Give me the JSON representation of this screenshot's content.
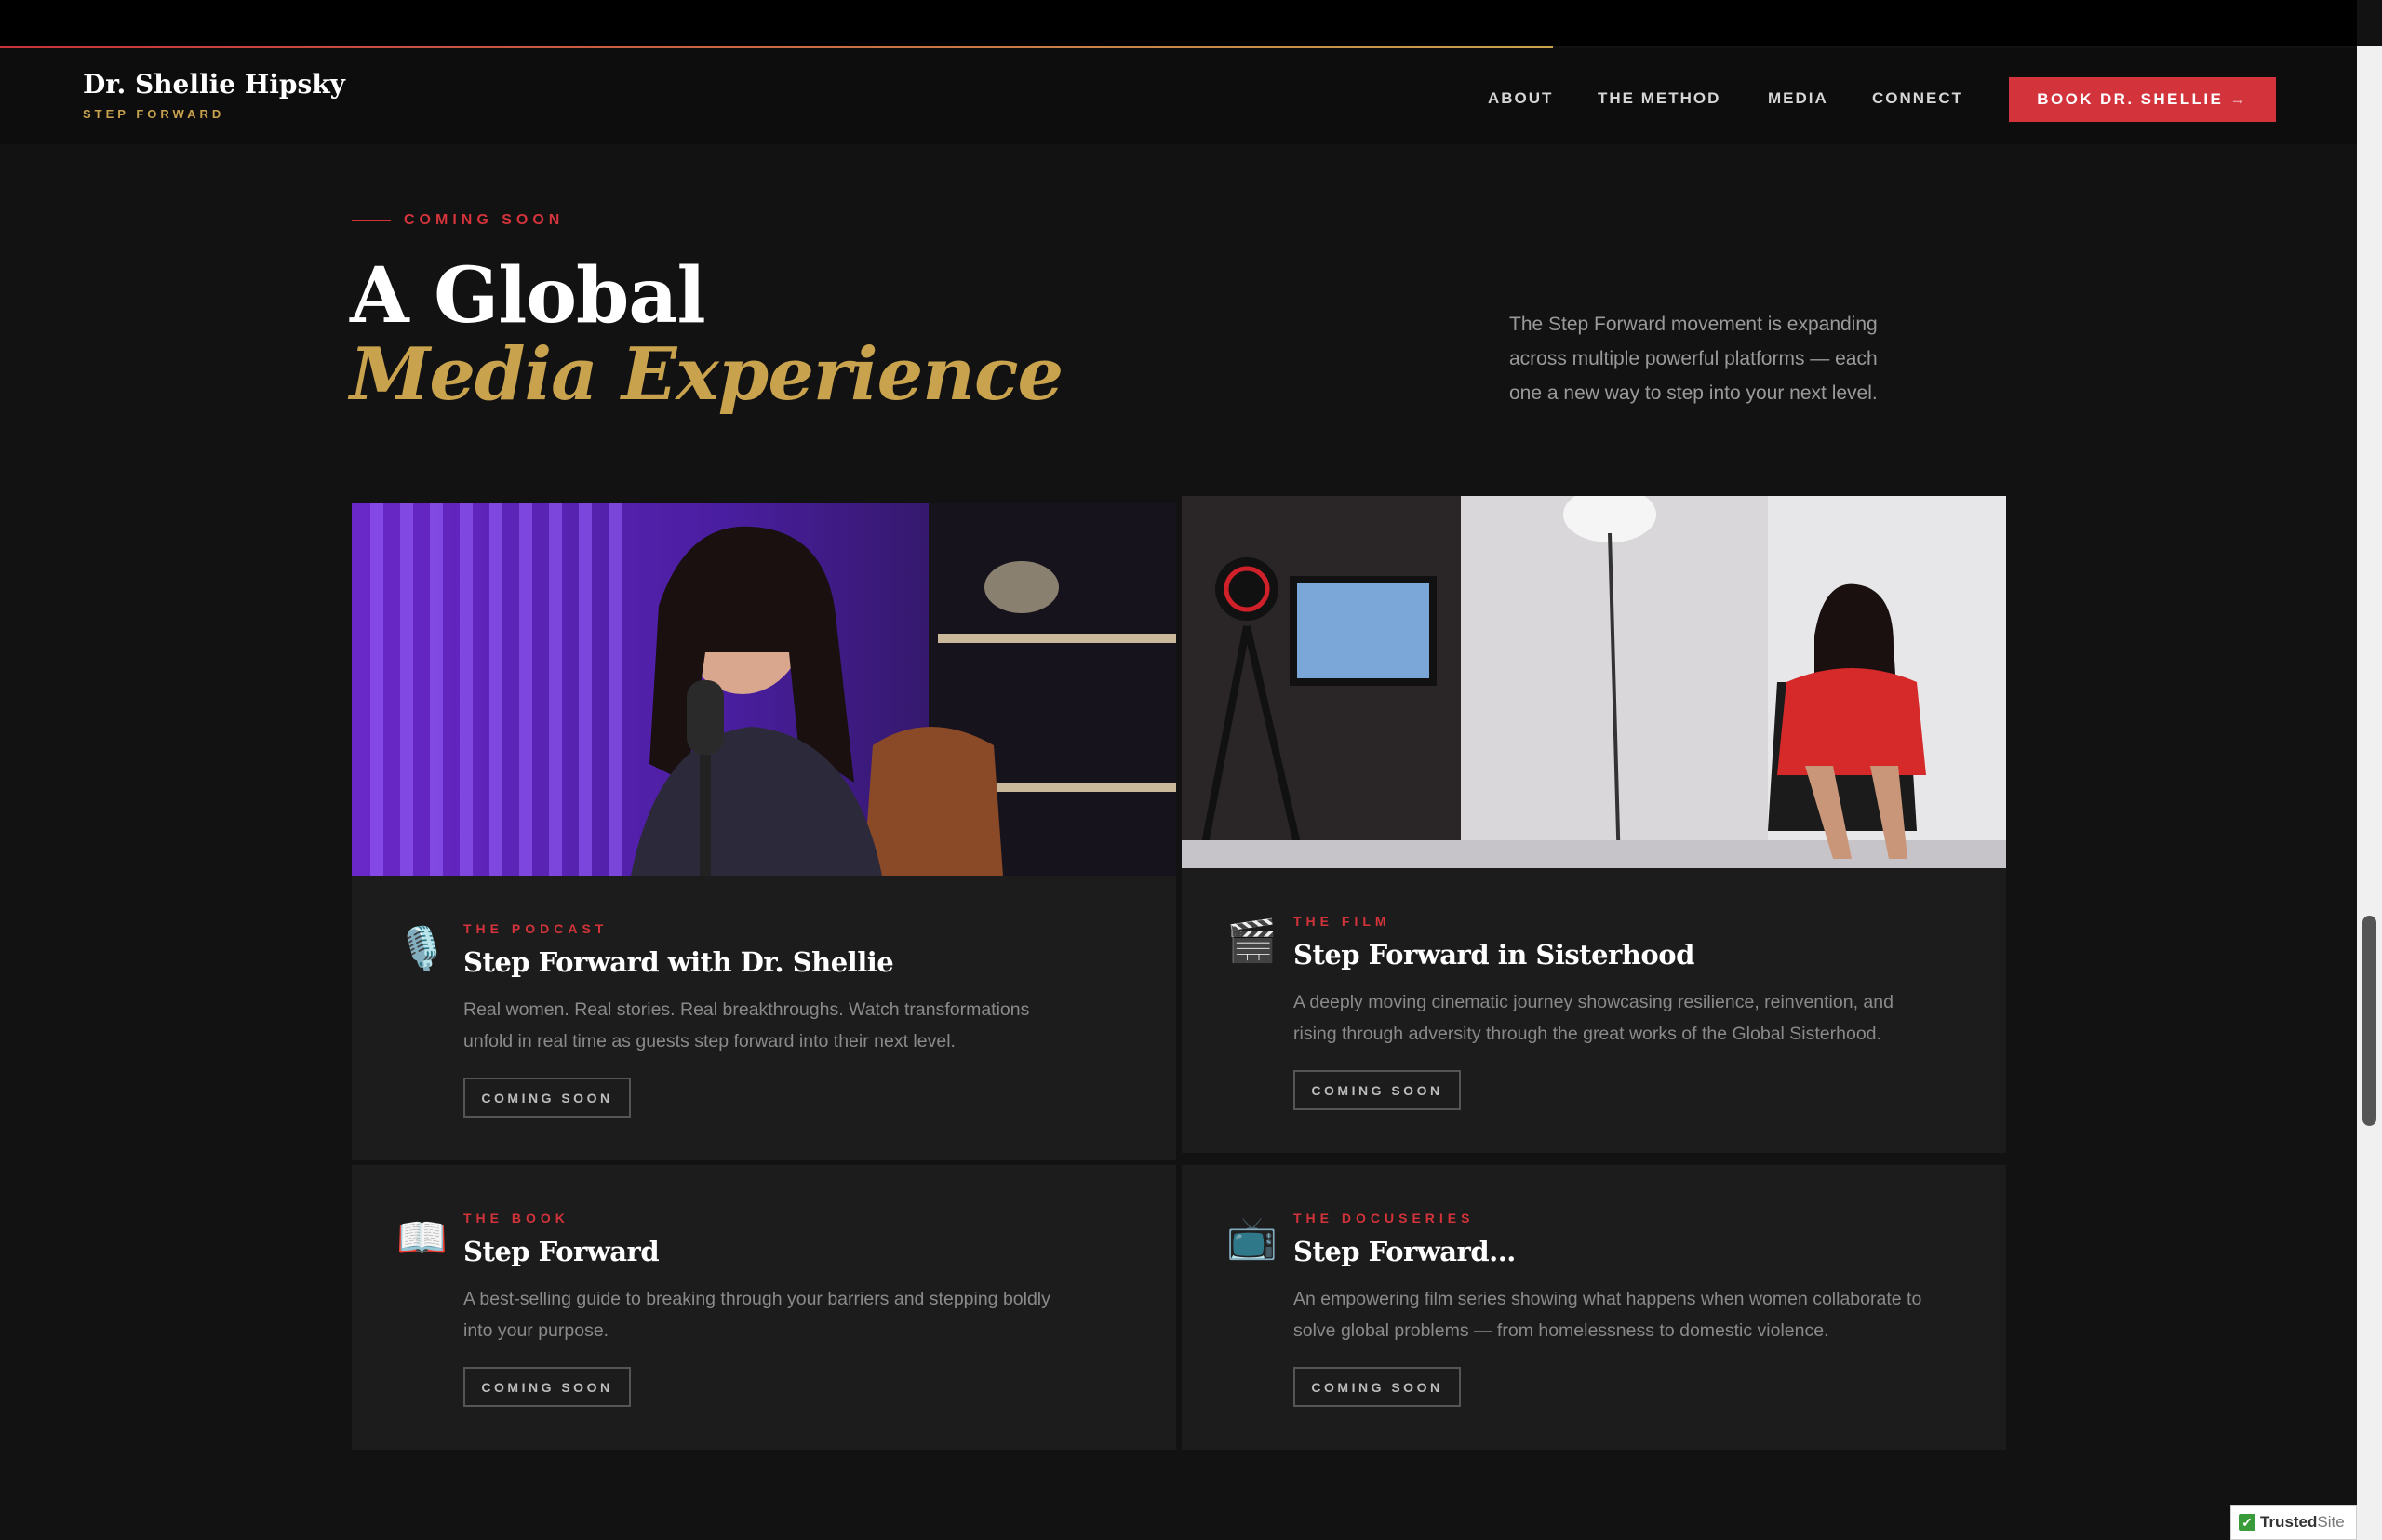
{
  "header": {
    "logo_name": "Dr. Shellie Hipsky",
    "logo_tagline": "STEP FORWARD",
    "nav": [
      "ABOUT",
      "THE METHOD",
      "MEDIA",
      "CONNECT"
    ],
    "cta_label": "BOOK DR. SHELLIE →"
  },
  "hero": {
    "eyebrow": "COMING SOON",
    "title_line1": "A Global",
    "title_line2": "Media Experience",
    "intro": "The Step Forward movement is expanding across multiple powerful platforms — each one a new way to step into your next level."
  },
  "cards": [
    {
      "icon": "microphone-icon",
      "label": "THE PODCAST",
      "title": "Step Forward with Dr. Shellie",
      "description": "Real women. Real stories. Real breakthroughs. Watch transformations unfold in real time as guests step forward into their next level.",
      "button": "COMING SOON"
    },
    {
      "icon": "clapperboard-icon",
      "label": "THE FILM",
      "title": "Step Forward in Sisterhood",
      "description": "A deeply moving cinematic journey showcasing resilience, reinvention, and rising through adversity through the great works of the Global Sisterhood.",
      "button": "COMING SOON"
    },
    {
      "icon": "open-book-icon",
      "label": "THE BOOK",
      "title": "Step Forward",
      "description": "A best-selling guide to breaking through your barriers and stepping boldly into your purpose.",
      "button": "COMING SOON"
    },
    {
      "icon": "television-icon",
      "label": "THE DOCUSERIES",
      "title": "Step Forward...",
      "description": "An empowering film series showing what happens when women collaborate to solve global problems — from homelessness to domestic violence.",
      "button": "COMING SOON"
    }
  ],
  "badge": {
    "brand": "Trusted",
    "suffix": "Site"
  },
  "colors": {
    "accent_red": "#d3333b",
    "accent_gold": "#c9a24e",
    "background": "#121212",
    "card": "#1c1c1c"
  }
}
